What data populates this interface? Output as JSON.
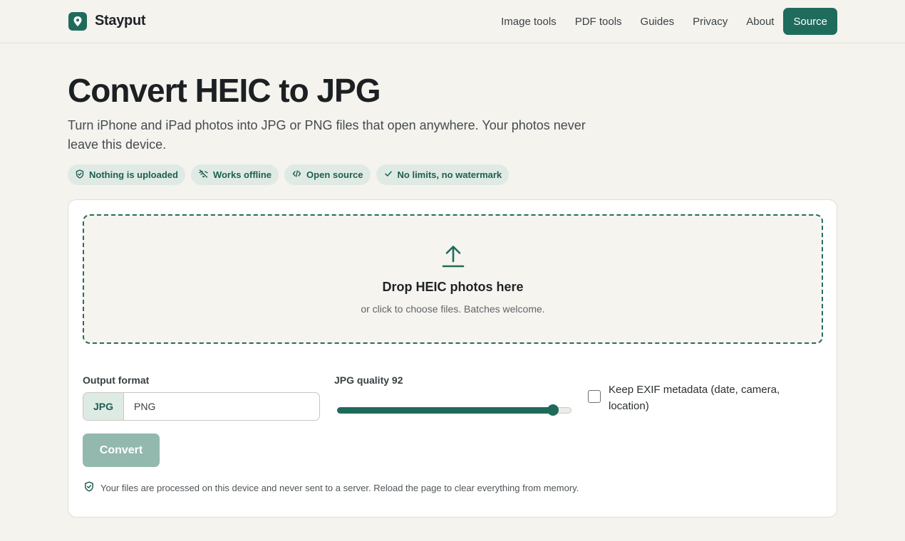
{
  "header": {
    "brand_name": "Stayput",
    "nav": [
      "Image tools",
      "PDF tools",
      "Guides",
      "Privacy",
      "About"
    ],
    "source_label": "Source"
  },
  "hero": {
    "title": "Convert HEIC to JPG",
    "subtitle": "Turn iPhone and iPad photos into JPG or PNG files that open anywhere. Your photos never leave this device."
  },
  "badges": [
    {
      "label": "Nothing is uploaded",
      "icon": "shield-check-icon"
    },
    {
      "label": "Works offline",
      "icon": "wifi-off-icon"
    },
    {
      "label": "Open source",
      "icon": "code-icon"
    },
    {
      "label": "No limits, no watermark",
      "icon": "check-icon"
    }
  ],
  "dropzone": {
    "icon": "upload-icon",
    "title": "Drop HEIC photos here",
    "subtitle": "or click to choose files. Batches welcome."
  },
  "options": {
    "format_label": "Output format",
    "formats": [
      "JPG",
      "PNG"
    ],
    "selected_format": "JPG",
    "quality_label": "JPG quality 92",
    "quality_value": 92,
    "quality_min": 0,
    "quality_max": 100,
    "exif_label": "Keep EXIF metadata (date, camera, location)",
    "exif_checked": false
  },
  "convert_label": "Convert",
  "privacy_note": "Your files are processed on this device and never sent to a server. Reload the page to clear everything from memory.",
  "colors": {
    "accent": "#1f6b5c",
    "background": "#f5f3ee",
    "badge_bg": "#dfeae4",
    "convert_disabled": "#93b8ae"
  }
}
